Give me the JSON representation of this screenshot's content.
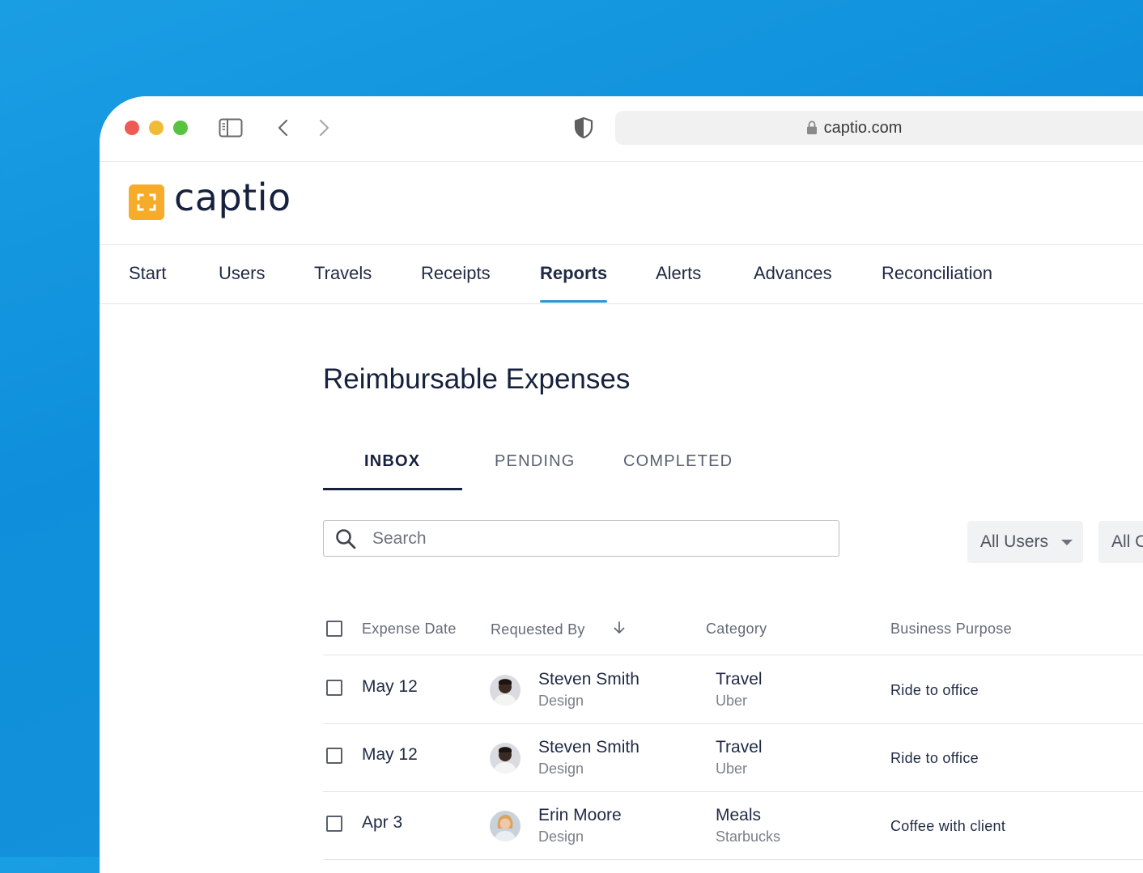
{
  "browser": {
    "url": "captio.com"
  },
  "app": {
    "logo_text": "captio",
    "brand_color": "#f6ac2a"
  },
  "nav": {
    "items": [
      {
        "label": "Start"
      },
      {
        "label": "Users"
      },
      {
        "label": "Travels"
      },
      {
        "label": "Receipts"
      },
      {
        "label": "Reports",
        "active": true
      },
      {
        "label": "Alerts"
      },
      {
        "label": "Advances"
      },
      {
        "label": "Reconciliation"
      }
    ],
    "accent_color": "#2a96d4"
  },
  "page": {
    "title": "Reimbursable Expenses"
  },
  "tabs": [
    {
      "label": "INBOX",
      "active": true
    },
    {
      "label": "PENDING"
    },
    {
      "label": "COMPLETED"
    }
  ],
  "search": {
    "placeholder": "Search"
  },
  "filters": {
    "users": "All Users",
    "categories": "All C"
  },
  "table": {
    "headers": {
      "date": "Expense Date",
      "requested_by": "Requested By",
      "category": "Category",
      "purpose": "Business Purpose"
    },
    "rows": [
      {
        "date": "May 12",
        "name": "Steven Smith",
        "dept": "Design",
        "category": "Travel",
        "vendor": "Uber",
        "purpose": "Ride to office"
      },
      {
        "date": "May 12",
        "name": "Steven Smith",
        "dept": "Design",
        "category": "Travel",
        "vendor": "Uber",
        "purpose": "Ride to office"
      },
      {
        "date": "Apr 3",
        "name": "Erin Moore",
        "dept": "Design",
        "category": "Meals",
        "vendor": "Starbucks",
        "purpose": "Coffee with client"
      }
    ]
  }
}
